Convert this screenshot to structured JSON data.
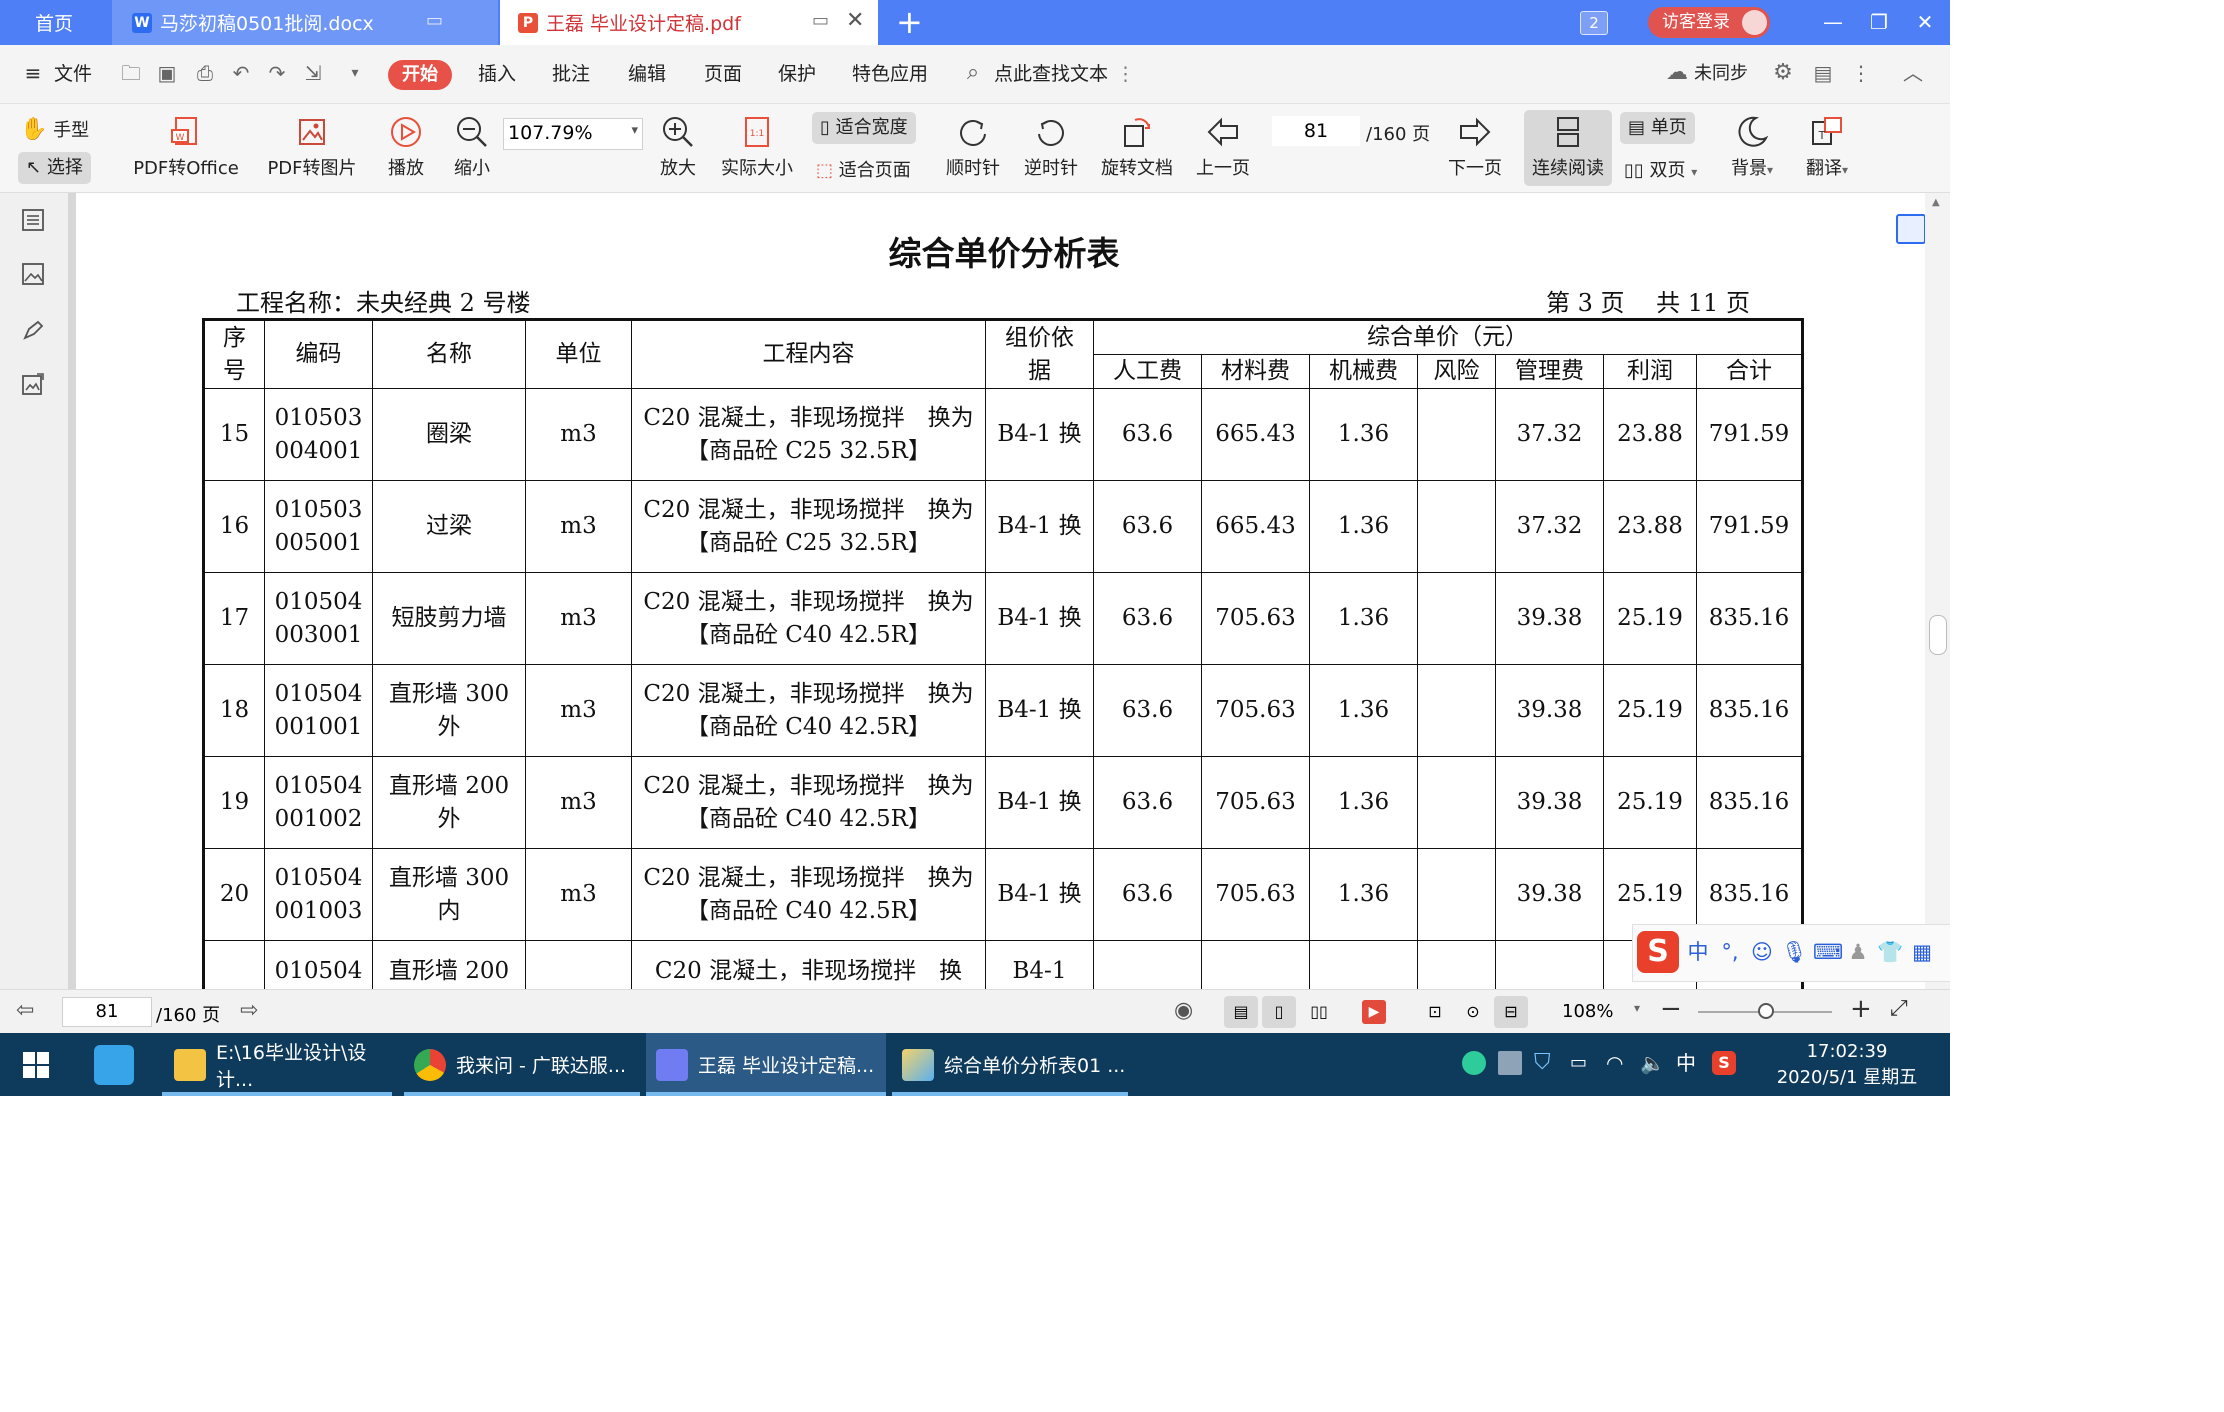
{
  "titlebar": {
    "tab_home": "首页",
    "tab_doc": "马莎初稿0501批阅.docx",
    "tab_pdf": "王磊 毕业设计定稿.pdf",
    "window_count": "2",
    "login": "访客登录"
  },
  "menubar": {
    "file": "文件",
    "start": "开始",
    "items": [
      "插入",
      "批注",
      "编辑",
      "页面",
      "保护",
      "特色应用"
    ],
    "search": "点此查找文本",
    "sync": "未同步"
  },
  "toolbar": {
    "hand": "手型",
    "select": "选择",
    "pdf_to_office": "PDF转Office",
    "pdf_to_image": "PDF转图片",
    "play": "播放",
    "zoom_out": "缩小",
    "zoom_value": "107.79%",
    "zoom_in": "放大",
    "actual_size": "实际大小",
    "fit_width": "适合宽度",
    "fit_page": "适合页面",
    "rotate_cw": "顺时针",
    "rotate_ccw": "逆时针",
    "rotate_doc": "旋转文档",
    "prev_page": "上一页",
    "page_current": "81",
    "page_total": "/160 页",
    "next_page": "下一页",
    "continuous": "连续阅读",
    "single": "单页",
    "double": "双页",
    "background": "背景",
    "translate": "翻译"
  },
  "document": {
    "title": "综合单价分析表",
    "project": "工程名称：未央经典 2 号楼",
    "pageinfo": "第 3 页　 共 11 页",
    "headers": {
      "seq": "序号",
      "code": "编码",
      "name": "名称",
      "unit": "单位",
      "content": "工程内容",
      "basis": "组价依据",
      "group": "综合单价（元）",
      "sub": [
        "人工费",
        "材料费",
        "机械费",
        "风险",
        "管理费",
        "利润",
        "合计"
      ]
    },
    "rows": [
      {
        "seq": "15",
        "code": "010503 004001",
        "name": "圈梁",
        "unit": "m3",
        "content": "C20 混凝土，非现场搅拌　换为【商品砼 C25 32.5R】",
        "basis": "B4-1 换",
        "labor": "63.6",
        "material": "665.43",
        "machine": "1.36",
        "risk": "",
        "mgmt": "37.32",
        "profit": "23.88",
        "total": "791.59"
      },
      {
        "seq": "16",
        "code": "010503 005001",
        "name": "过梁",
        "unit": "m3",
        "content": "C20 混凝土，非现场搅拌　换为【商品砼 C25 32.5R】",
        "basis": "B4-1 换",
        "labor": "63.6",
        "material": "665.43",
        "machine": "1.36",
        "risk": "",
        "mgmt": "37.32",
        "profit": "23.88",
        "total": "791.59"
      },
      {
        "seq": "17",
        "code": "010504 003001",
        "name": "短肢剪力墙",
        "unit": "m3",
        "content": "C20 混凝土，非现场搅拌　换为【商品砼 C40 42.5R】",
        "basis": "B4-1 换",
        "labor": "63.6",
        "material": "705.63",
        "machine": "1.36",
        "risk": "",
        "mgmt": "39.38",
        "profit": "25.19",
        "total": "835.16"
      },
      {
        "seq": "18",
        "code": "010504 001001",
        "name": "直形墙 300 外",
        "unit": "m3",
        "content": "C20 混凝土，非现场搅拌　换为【商品砼 C40 42.5R】",
        "basis": "B4-1 换",
        "labor": "63.6",
        "material": "705.63",
        "machine": "1.36",
        "risk": "",
        "mgmt": "39.38",
        "profit": "25.19",
        "total": "835.16"
      },
      {
        "seq": "19",
        "code": "010504 001002",
        "name": "直形墙 200 外",
        "unit": "m3",
        "content": "C20 混凝土，非现场搅拌　换为【商品砼 C40 42.5R】",
        "basis": "B4-1 换",
        "labor": "63.6",
        "material": "705.63",
        "machine": "1.36",
        "risk": "",
        "mgmt": "39.38",
        "profit": "25.19",
        "total": "835.16"
      },
      {
        "seq": "20",
        "code": "010504 001003",
        "name": "直形墙 300 内",
        "unit": "m3",
        "content": "C20 混凝土，非现场搅拌　换为【商品砼 C40 42.5R】",
        "basis": "B4-1 换",
        "labor": "63.6",
        "material": "705.63",
        "machine": "1.36",
        "risk": "",
        "mgmt": "39.38",
        "profit": "25.19",
        "total": "835.16"
      },
      {
        "seq": "",
        "code": "010504",
        "name": "直形墙 200",
        "unit": "",
        "content": "C20 混凝土，非现场搅拌　换",
        "basis": "B4-1",
        "labor": "",
        "material": "",
        "machine": "",
        "risk": "",
        "mgmt": "",
        "profit": "",
        "total": ""
      }
    ]
  },
  "statusbar": {
    "page_current": "81",
    "page_total": "/160 页",
    "zoom": "108%"
  },
  "taskbar": {
    "items": [
      "E:\\16毕业设计\\设计...",
      "我来问 - 广联达服...",
      "王磊 毕业设计定稿...",
      "综合单价分析表01 ..."
    ],
    "ime_lang": "中",
    "time": "17:02:39",
    "date": "2020/5/1 星期五"
  },
  "ime": {
    "lang": "中"
  },
  "colors": {
    "accent": "#4e7ff6",
    "start": "#e85148",
    "taskbar": "#0e3a5c"
  }
}
